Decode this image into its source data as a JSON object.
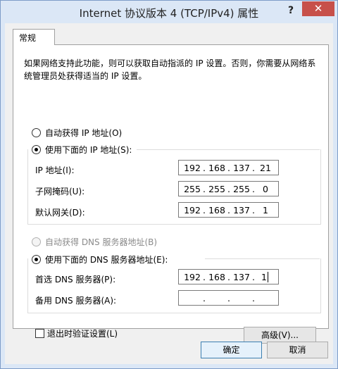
{
  "window": {
    "title": "Internet 协议版本 4 (TCP/IPv4) 属性",
    "help": "?",
    "close": "✕"
  },
  "tabs": [
    {
      "label": "常规",
      "active": true
    }
  ],
  "description": "如果网络支持此功能，则可以获取自动指派的 IP 设置。否则，你需要从网络系统管理员处获得适当的 IP 设置。",
  "ip_section": {
    "auto_label": "自动获得 IP 地址(O)",
    "manual_label": "使用下面的 IP 地址(S):",
    "selected": "manual",
    "fields": [
      {
        "label": "IP 地址(I):",
        "octets": [
          "192",
          "168",
          "137",
          "21"
        ]
      },
      {
        "label": "子网掩码(U):",
        "octets": [
          "255",
          "255",
          "255",
          "0"
        ]
      },
      {
        "label": "默认网关(D):",
        "octets": [
          "192",
          "168",
          "137",
          "1"
        ]
      }
    ]
  },
  "dns_section": {
    "auto_label": "自动获得 DNS 服务器地址(B)",
    "manual_label": "使用下面的 DNS 服务器地址(E):",
    "selected": "manual",
    "auto_disabled": true,
    "fields": [
      {
        "label": "首选 DNS 服务器(P):",
        "octets": [
          "192",
          "168",
          "137",
          "1"
        ]
      },
      {
        "label": "备用 DNS 服务器(A):",
        "octets": [
          "",
          "",
          "",
          ""
        ]
      }
    ]
  },
  "validate_checkbox": {
    "label": "退出时验证设置(L)",
    "checked": false
  },
  "buttons": {
    "advanced": "高级(V)...",
    "ok": "确定",
    "cancel": "取消"
  },
  "colors": {
    "titlebar": "#dbe7f6",
    "close": "#c7504a",
    "dialog_body": "#f0f0f0"
  }
}
